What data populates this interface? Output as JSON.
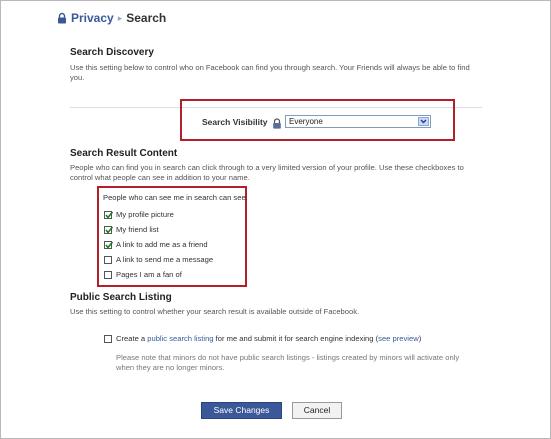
{
  "breadcrumb": {
    "parent": "Privacy",
    "separator": "▸",
    "current": "Search"
  },
  "discovery": {
    "title": "Search Discovery",
    "description": "Use this setting below to control who on Facebook can find you through search. Your Friends will always be able to find you.",
    "visibility_label": "Search Visibility",
    "visibility_value": "Everyone"
  },
  "result_content": {
    "title": "Search Result Content",
    "description": "People who can find you in search can click through to a very limited version of your profile. Use these checkboxes to control what people can see in addition to your name.",
    "list_header": "People who can see me in search can see:",
    "items": [
      {
        "label": "My profile picture",
        "checked": true
      },
      {
        "label": "My friend list",
        "checked": true
      },
      {
        "label": "A link to add me as a friend",
        "checked": true
      },
      {
        "label": "A link to send me a message",
        "checked": false
      },
      {
        "label": "Pages I am a fan of",
        "checked": false
      }
    ]
  },
  "public_listing": {
    "title": "Public Search Listing",
    "description": "Use this setting to control whether your search result is available outside of Facebook.",
    "checkbox_prefix": "Create a ",
    "checkbox_link": "public search listing",
    "checkbox_middle": " for me and submit it for search engine indexing (",
    "preview_link": "see preview",
    "checkbox_suffix": ")",
    "checked": false,
    "note": "Please note that minors do not have public search listings - listings created by minors will activate only when they are no longer minors."
  },
  "buttons": {
    "save": "Save Changes",
    "cancel": "Cancel"
  },
  "colors": {
    "brand": "#3b5998",
    "highlight": "#b3202a"
  },
  "icons": {
    "breadcrumb": "privacy-lock-icon",
    "visibility": "lock-icon",
    "dropdown": "chevron-down-icon",
    "check": "checkmark-icon"
  }
}
